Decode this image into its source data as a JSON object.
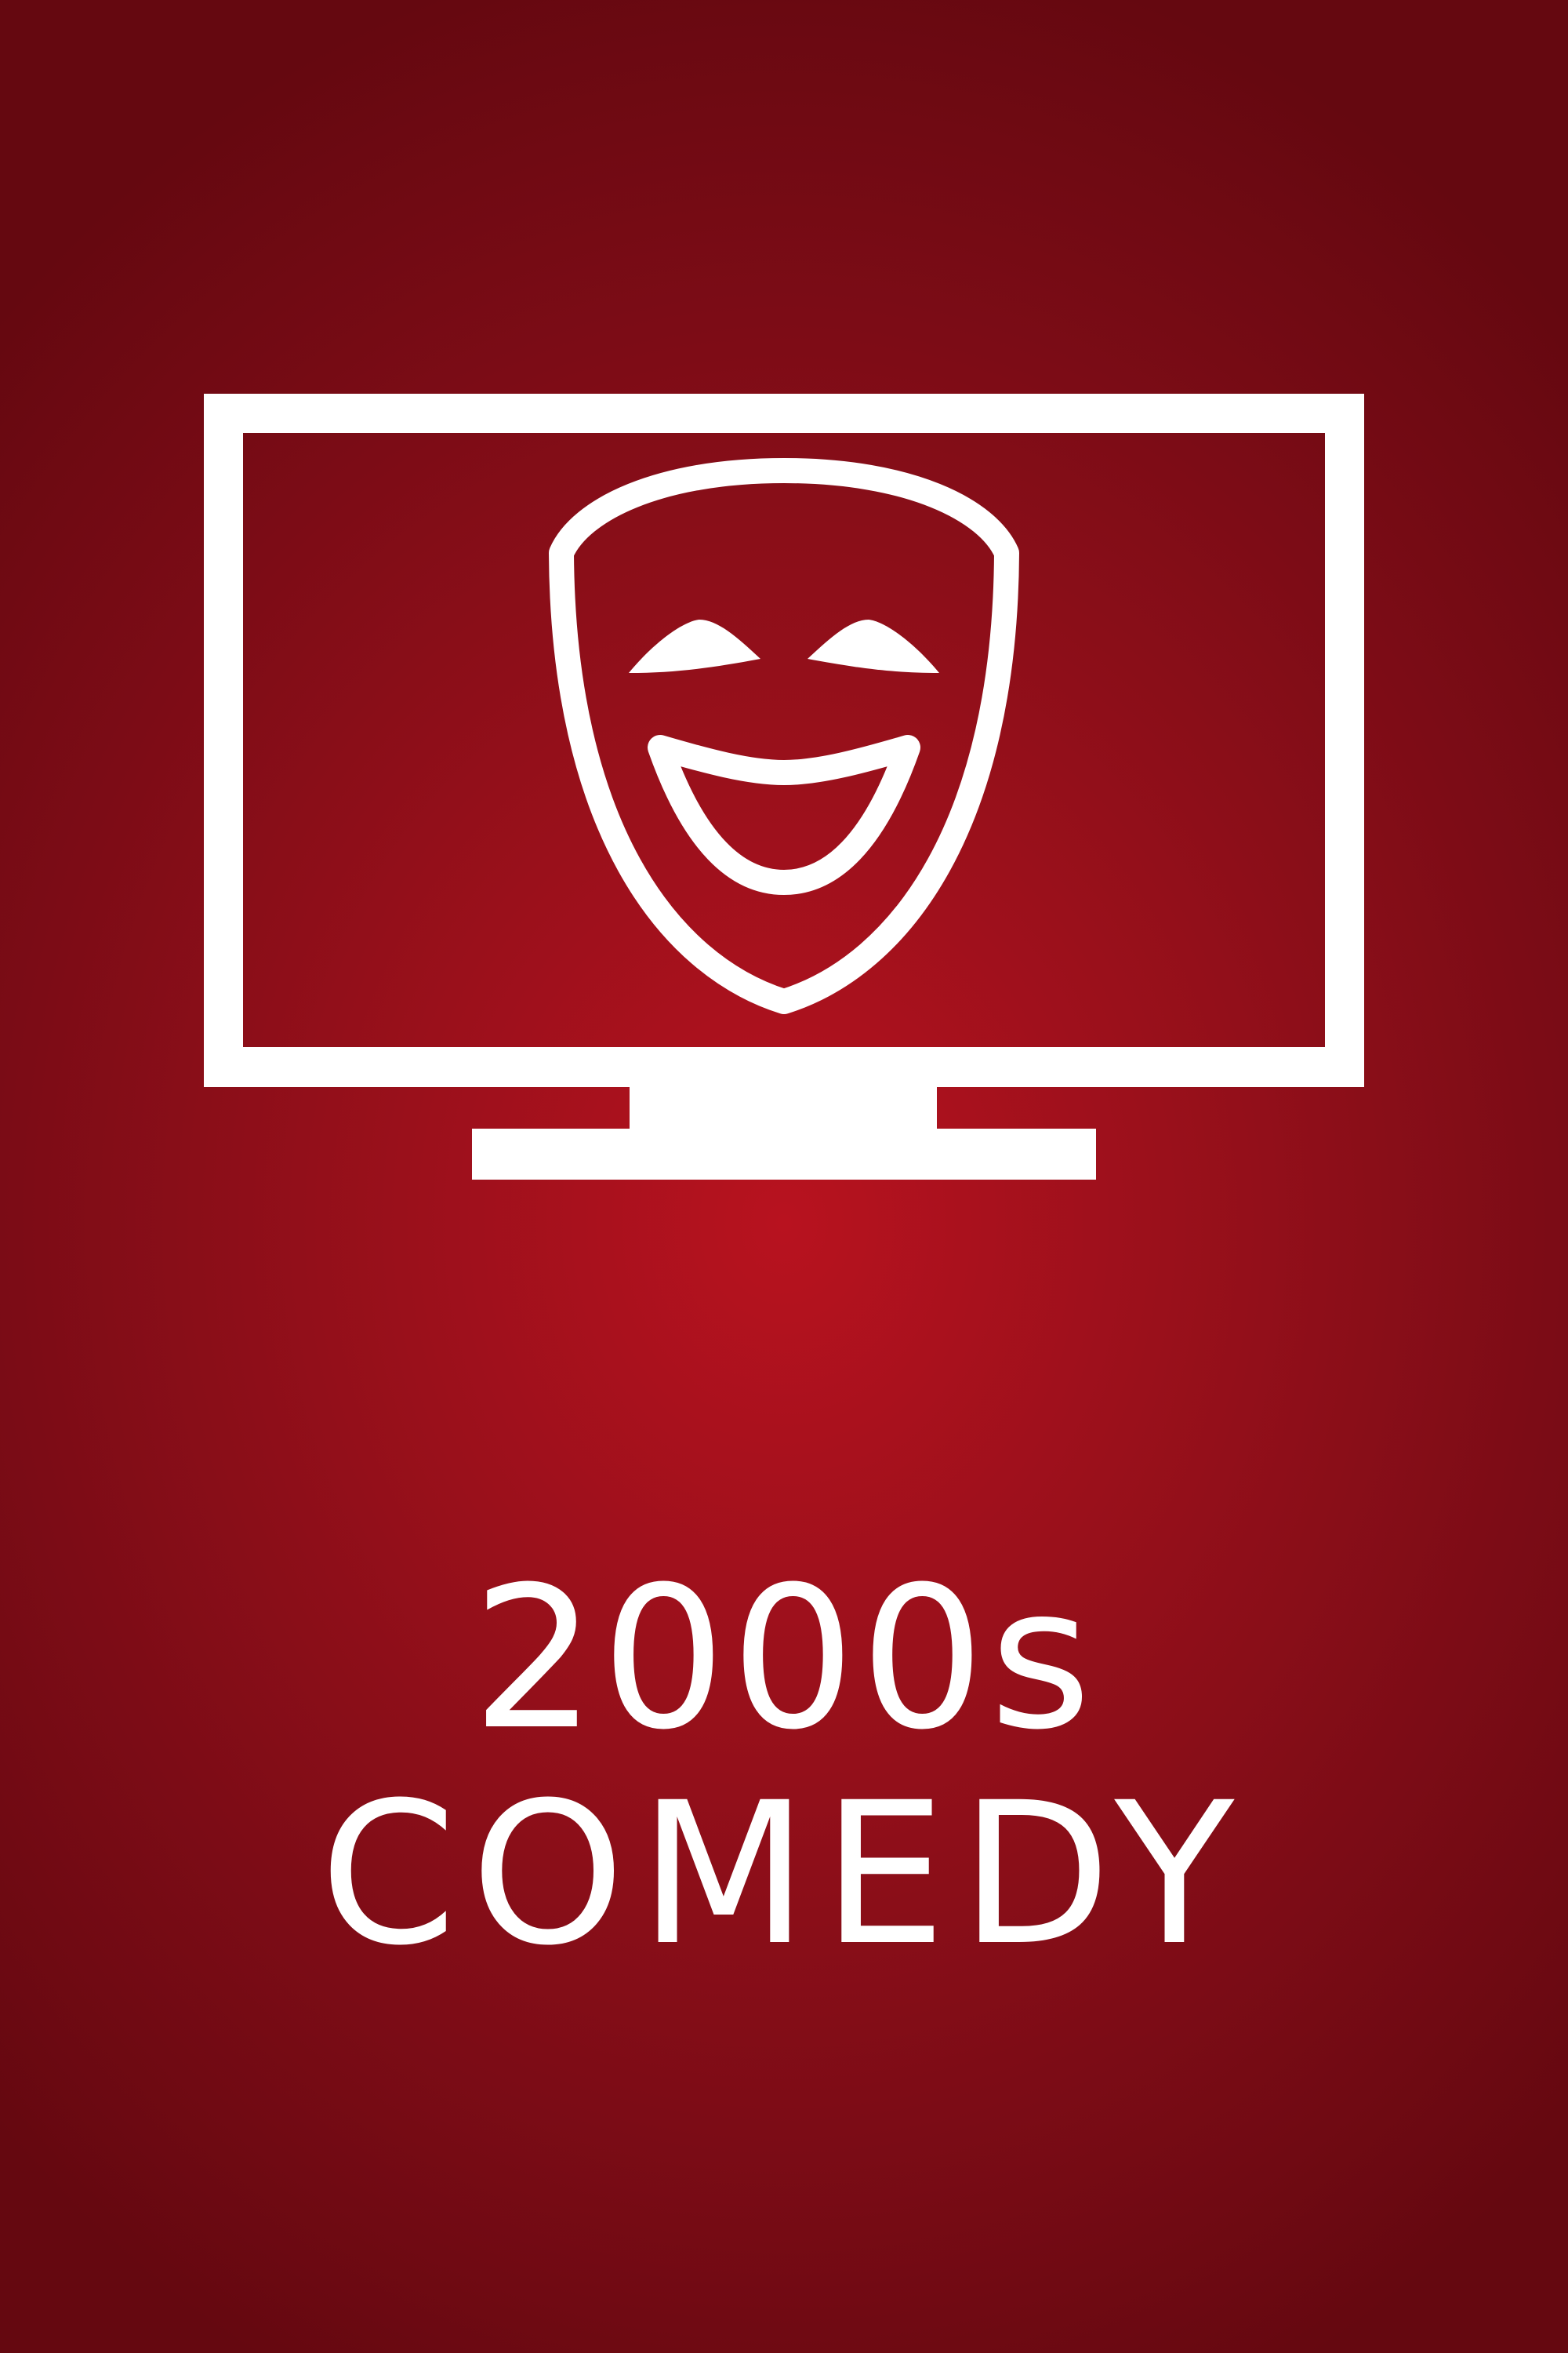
{
  "poster": {
    "background_color": "#a6111c",
    "foreground_color": "#ffffff",
    "icon": "tv-comedy-mask-icon",
    "title_line_1": "2000s",
    "title_line_2": "COMEDY"
  }
}
